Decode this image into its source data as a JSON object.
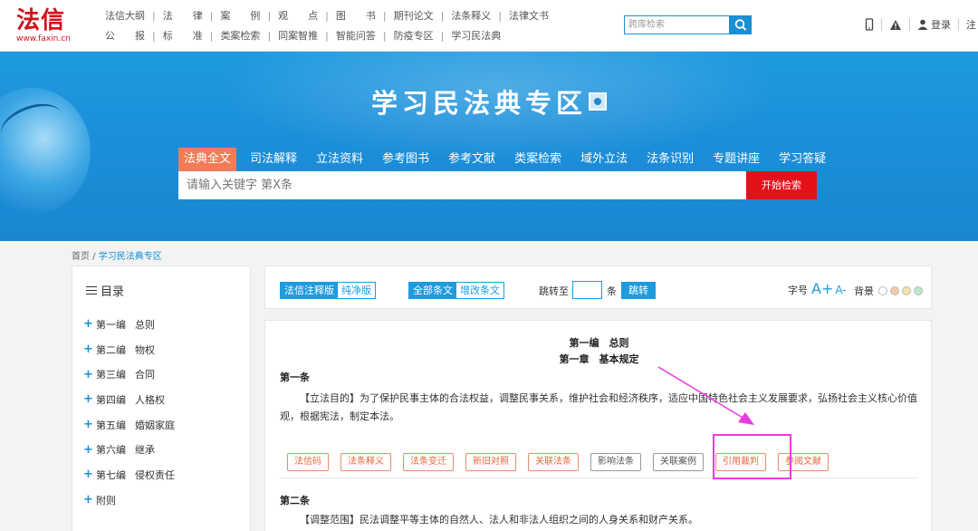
{
  "header": {
    "logo_text": "法信",
    "logo_url": "www.faxin.cn",
    "nav_row1": [
      "法信大纲",
      "法　　律",
      "案　　例",
      "观　　点",
      "图　　书",
      "期刊论文",
      "法条释义",
      "法律文书"
    ],
    "nav_row2": [
      "公　　报",
      "标　　准",
      "类案检索",
      "同案智推",
      "智能问答",
      "防疫专区",
      "学习民法典"
    ],
    "search_placeholder": "跨库检索",
    "login_label": "登录",
    "register_label": "注"
  },
  "banner": {
    "title": "学习民法典专区",
    "tabs": [
      "法典全文",
      "司法解释",
      "立法资料",
      "参考图书",
      "参考文献",
      "类案检索",
      "域外立法",
      "法条识别",
      "专题讲座",
      "学习答疑"
    ],
    "active_tab": 0,
    "search_placeholder": "请输入关键字 第X条",
    "search_button": "开始检索"
  },
  "breadcrumb": {
    "home": "首页",
    "separator": " / ",
    "current": "学习民法典专区"
  },
  "sidebar": {
    "title": "目录",
    "items": [
      {
        "part": "第一编",
        "name": "总则"
      },
      {
        "part": "第二编",
        "name": "物权"
      },
      {
        "part": "第三编",
        "name": "合同"
      },
      {
        "part": "第四编",
        "name": "人格权"
      },
      {
        "part": "第五编",
        "name": "婚姻家庭"
      },
      {
        "part": "第六编",
        "name": "继承"
      },
      {
        "part": "第七编",
        "name": "侵权责任"
      },
      {
        "part": "附则",
        "name": ""
      }
    ]
  },
  "toolbar": {
    "version_options": [
      "法信注释版",
      "纯净版"
    ],
    "version_selected": 0,
    "scope_options": [
      "全部条文",
      "增改条文"
    ],
    "scope_selected": 0,
    "jump_label": "跳转至",
    "jump_unit": "条",
    "jump_button": "跳转",
    "font_label": "字号",
    "font_plus": "A+",
    "font_minus": "A-",
    "bg_label": "背景",
    "bg_colors": [
      "#ffffff",
      "#f6c7a8",
      "#f3e3a6",
      "#bfe8c9"
    ]
  },
  "article": {
    "part_title": "第一编　总则",
    "chapter_title": "第一章　基本规定",
    "articles": [
      {
        "heading": "第一条",
        "text": "【立法目的】为了保护民事主体的合法权益，调整民事关系，维护社会和经济秩序，适应中国特色社会主义发展要求，弘扬社会主义核心价值观，根据宪法，制定本法。"
      },
      {
        "heading": "第二条",
        "text": "【调整范围】民法调整平等主体的自然人、法人和非法人组织之间的人身关系和财产关系。"
      }
    ],
    "action_buttons": [
      {
        "label": "法信码",
        "style": "orange"
      },
      {
        "label": "法条释义",
        "style": "orange"
      },
      {
        "label": "法条变迁",
        "style": "orange"
      },
      {
        "label": "新旧对照",
        "style": "orange"
      },
      {
        "label": "关联法条",
        "style": "orange"
      },
      {
        "label": "影响法条",
        "style": "gray"
      },
      {
        "label": "关联案例",
        "style": "gray"
      },
      {
        "label": "引用裁判",
        "style": "orange"
      },
      {
        "label": "参阅文献",
        "style": "orange"
      }
    ]
  },
  "colors": {
    "brand_red": "#d0121b",
    "accent_blue": "#1e9be0",
    "active_tab": "#f07d58",
    "search_red": "#e5111a",
    "annotation_magenta": "#e83ce0"
  }
}
